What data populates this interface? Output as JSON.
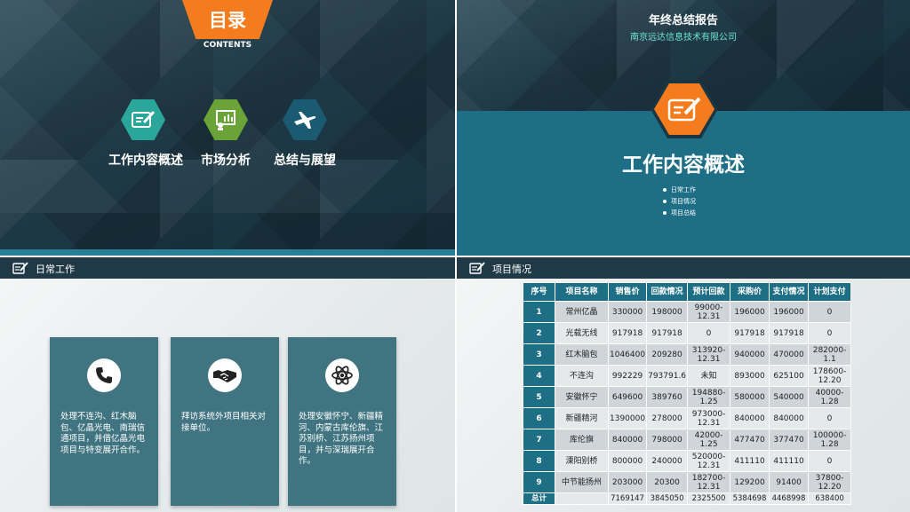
{
  "slide1": {
    "tab_title": "目录",
    "tab_subtitle": "CONTENTS",
    "items": [
      {
        "label": "工作内容概述",
        "color": "#2aa69a",
        "icon": "edit-icon"
      },
      {
        "label": "市场分析",
        "color": "#6aa337",
        "icon": "presentation-icon"
      },
      {
        "label": "总结与展望",
        "color": "#1b5b72",
        "icon": "airplane-icon"
      }
    ]
  },
  "slide2": {
    "title": "年终总结报告",
    "company": "南京远达信息技术有限公司",
    "heading": "工作内容概述",
    "bullets": [
      "日常工作",
      "项目情况",
      "项目总结"
    ],
    "accent": "#f47c1e"
  },
  "slide3": {
    "header": "日常工作",
    "cards": [
      {
        "icon": "phone-icon",
        "text": "处理不连沟、红木脑包、亿晶光电、南瑞信通项目，并借亿晶光电项目与特变展开合作。"
      },
      {
        "icon": "handshake-icon",
        "text": "拜访系统外项目相关对接单位。"
      },
      {
        "icon": "atom-icon",
        "text": "处理安徽怀宁、新疆精河、内蒙古库伦旗、江苏别桥、江苏扬州项目，并与深瑞展开合作。"
      }
    ]
  },
  "slide4": {
    "header": "项目情况",
    "columns": [
      "序号",
      "项目名称",
      "销售价",
      "回款情况",
      "预计回款",
      "采购价",
      "支付情况",
      "计划支付"
    ],
    "rows": [
      [
        "1",
        "常州亿晶",
        "330000",
        "198000",
        "99000-12.31",
        "196000",
        "196000",
        "0"
      ],
      [
        "2",
        "光载无线",
        "917918",
        "917918",
        "0",
        "917918",
        "917918",
        "0"
      ],
      [
        "3",
        "红木脑包",
        "1046400",
        "209280",
        "313920-12.31",
        "940000",
        "470000",
        "282000-1.1"
      ],
      [
        "4",
        "不连沟",
        "992229",
        "793791.6",
        "未知",
        "893000",
        "625100",
        "178600-12.20"
      ],
      [
        "5",
        "安徽怀宁",
        "649600",
        "389760",
        "194880-1.25",
        "580000",
        "540000",
        "40000-1.28"
      ],
      [
        "6",
        "新疆精河",
        "1390000",
        "278000",
        "973000-12.31",
        "840000",
        "840000",
        "0"
      ],
      [
        "7",
        "库伦旗",
        "840000",
        "798000",
        "42000-1.25",
        "477470",
        "377470",
        "100000-1.28"
      ],
      [
        "8",
        "溧阳别桥",
        "800000",
        "240000",
        "520000-12.31",
        "411110",
        "411110",
        "0"
      ],
      [
        "9",
        "中节能扬州",
        "203000",
        "20300",
        "182700-12.31",
        "129200",
        "91400",
        "37800-12.20"
      ]
    ],
    "total": [
      "总计",
      "",
      "7169147",
      "3845050",
      "2325500",
      "5384698",
      "4468998",
      "638400"
    ]
  }
}
